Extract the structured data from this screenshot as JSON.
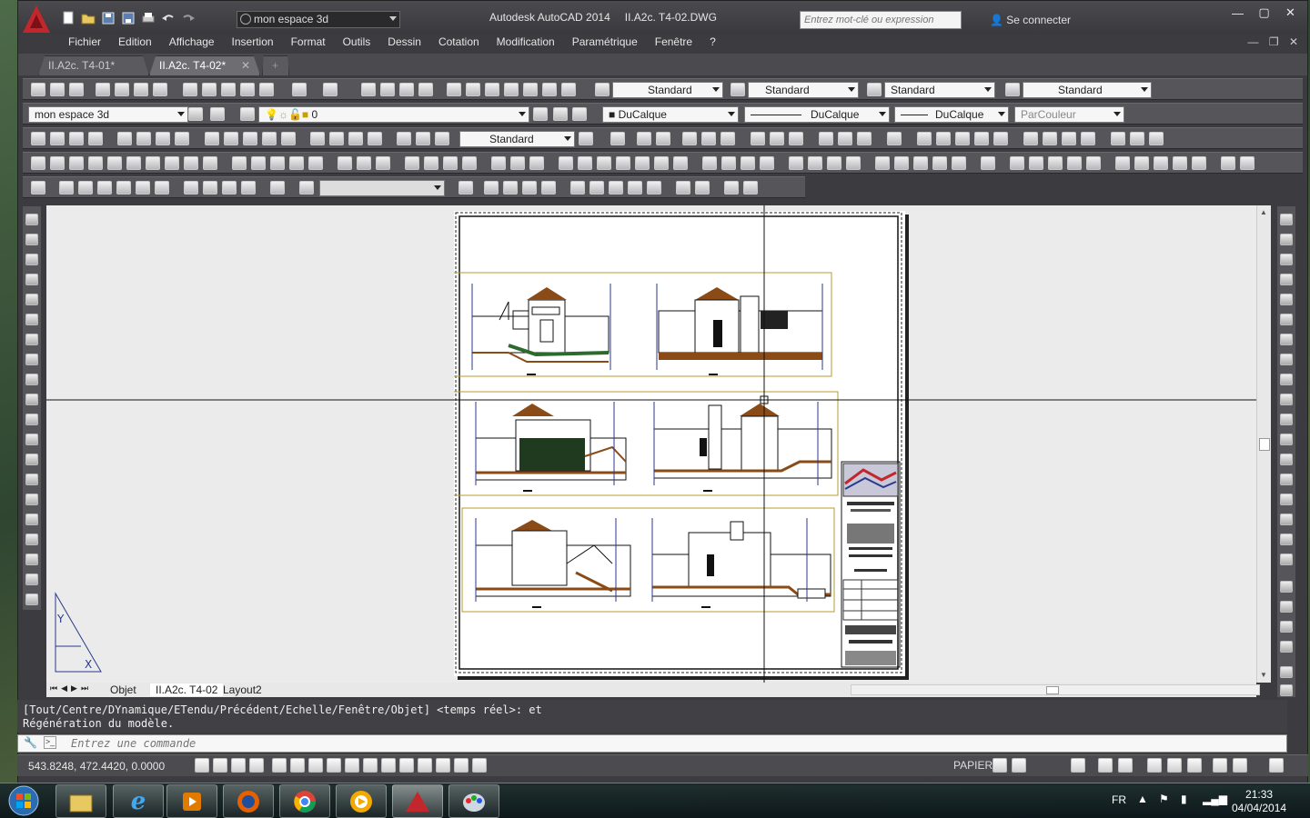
{
  "window": {
    "app_title": "Autodesk AutoCAD 2014",
    "file_title": "II.A2c. T4-02.DWG"
  },
  "quick_access": {
    "workspace": "mon espace 3d"
  },
  "search": {
    "placeholder": "Entrez mot-clé ou expression"
  },
  "account": {
    "signin_label": "Se connecter"
  },
  "menu": [
    "Fichier",
    "Edition",
    "Affichage",
    "Insertion",
    "Format",
    "Outils",
    "Dessin",
    "Cotation",
    "Modification",
    "Paramétrique",
    "Fenêtre",
    "?"
  ],
  "file_tabs": [
    {
      "label": "II.A2c. T4-01*",
      "active": false
    },
    {
      "label": "II.A2c. T4-02*",
      "active": true
    }
  ],
  "styles": {
    "text_style": "Standard",
    "dim_style": "Standard",
    "table_style": "Standard",
    "mleader_style": "Standard"
  },
  "layers": {
    "workspace": "mon espace 3d",
    "current_layer": "0",
    "color": "DuCalque",
    "linetype": "DuCalque",
    "lineweight": "DuCalque",
    "plotstyle": "ParCouleur"
  },
  "dim_toolbar": {
    "dimstyle": "Standard"
  },
  "layout_tabs": [
    "Objet",
    "II.A2c. T4-02",
    "Layout2"
  ],
  "command": {
    "history": [
      "[Tout/Centre/DYnamique/ETendu/Précédent/Echelle/Fenêtre/Objet] <temps réel>: et",
      "Régénération du modèle."
    ],
    "placeholder": "Entrez une commande"
  },
  "status": {
    "coordinates": "543.8248, 472.4420, 0.0000",
    "space": "PAPIER"
  },
  "tray": {
    "language": "FR",
    "time": "21:33",
    "date": "04/04/2014"
  },
  "colors": {
    "autocad_red": "#c1272d",
    "viewport_border": "#b59b2c",
    "wall_brown": "#8a4b16"
  }
}
